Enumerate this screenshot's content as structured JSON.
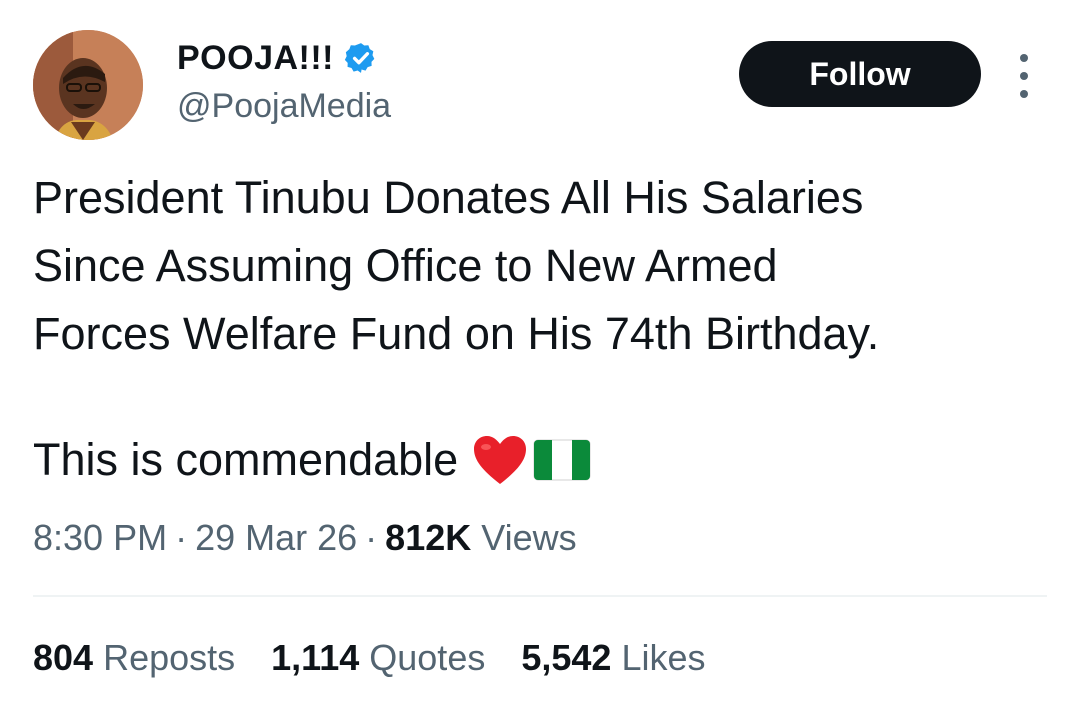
{
  "author": {
    "display_name": "POOJA!!!",
    "handle": "@PoojaMedia",
    "verified_color": "#1d9bf0"
  },
  "actions": {
    "follow_label": "Follow",
    "more_icon": "more-vertical-icon"
  },
  "tweet": {
    "lines": [
      "President Tinubu Donates All His Salaries",
      "Since Assuming Office to New Armed",
      "Forces Welfare Fund on His 74th Birthday."
    ],
    "second_paragraph": "This is commendable",
    "emojis": [
      "red-heart-emoji",
      "nigeria-flag-emoji"
    ]
  },
  "meta": {
    "time": "8:30 PM",
    "date": "29 Mar 26",
    "views_count": "812K",
    "views_label": "Views"
  },
  "stats": {
    "reposts_count": "804",
    "reposts_label": "Reposts",
    "quotes_count": "1,114",
    "quotes_label": "Quotes",
    "likes_count": "5,542",
    "likes_label": "Likes"
  },
  "colors": {
    "text_primary": "#0f1419",
    "text_secondary": "#536471",
    "button_bg": "#0f1419",
    "divider": "#eff3f4"
  }
}
